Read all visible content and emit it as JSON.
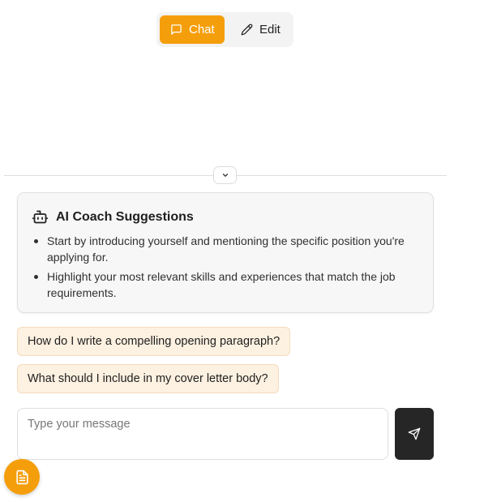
{
  "mode_toggle": {
    "chat_label": "Chat",
    "edit_label": "Edit",
    "active": "Chat",
    "chat_icon": "message-square-icon",
    "edit_icon": "pencil-icon"
  },
  "panel": {
    "collapse_icon": "chevron-down-icon"
  },
  "coach": {
    "title": "AI Coach Suggestions",
    "icon": "bot-icon",
    "tips": [
      "Start by introducing yourself and mentioning the specific position you're applying for.",
      "Highlight your most relevant skills and experiences that match the job requirements."
    ]
  },
  "suggestions": [
    "How do I write a compelling opening paragraph?",
    "What should I include in my cover letter body?"
  ],
  "composer": {
    "placeholder": "Type your message",
    "value": "",
    "send_icon": "send-icon"
  },
  "fab": {
    "icon": "document-icon"
  },
  "colors": {
    "accent": "#f59e0b",
    "suggestion_bg": "#fdf1e1",
    "send_button": "#262626",
    "card_bg": "#f7f7f7"
  }
}
